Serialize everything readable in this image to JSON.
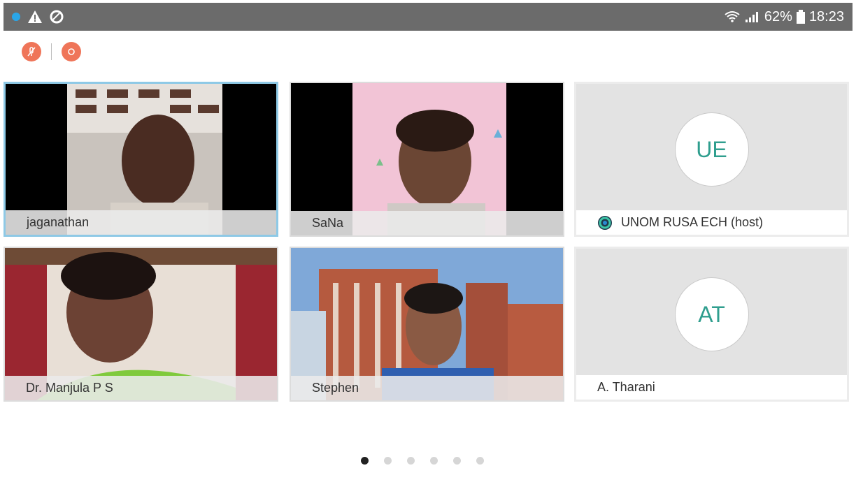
{
  "status_bar": {
    "battery": "62%",
    "time": "18:23"
  },
  "participants": [
    {
      "name": "jaganathan",
      "type": "video",
      "active": true
    },
    {
      "name": "SaNa",
      "type": "video"
    },
    {
      "name": "UNOM RUSA ECH (host)",
      "type": "avatar",
      "initials": "UE",
      "is_host": true
    },
    {
      "name": "Dr. Manjula P S",
      "type": "video"
    },
    {
      "name": "Stephen",
      "type": "video"
    },
    {
      "name": "A. Tharani",
      "type": "avatar",
      "initials": "AT"
    }
  ],
  "pagination": {
    "total_pages": 6,
    "current_page": 1
  },
  "colors": {
    "accent": "#ef7559",
    "avatar_text": "#2f9e8e",
    "active_border": "#8ec9e6"
  }
}
